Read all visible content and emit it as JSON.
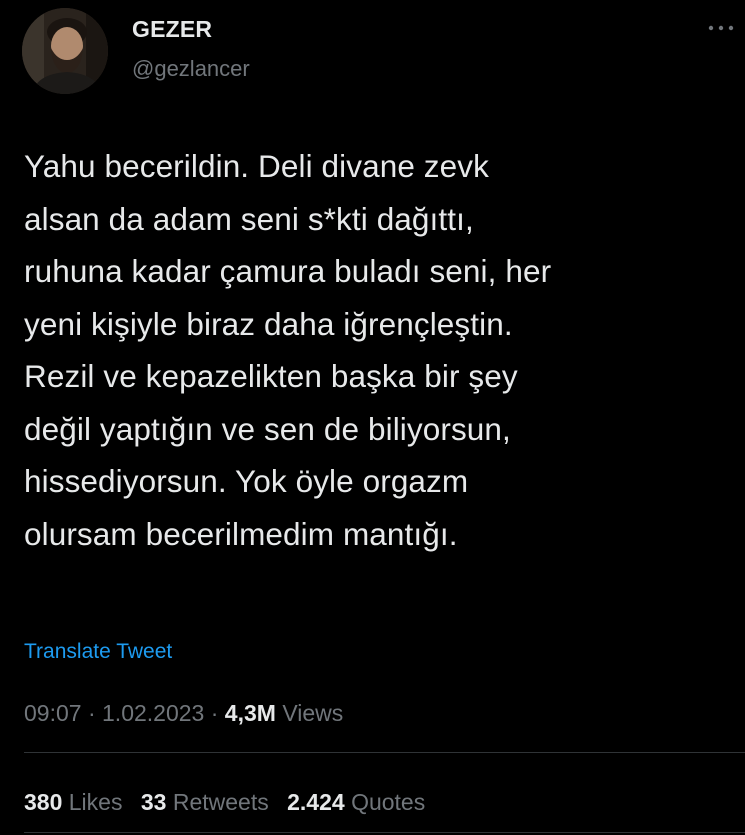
{
  "author": {
    "display_name": "GEZER",
    "handle": "@gezlancer",
    "avatar_icon": "user-avatar"
  },
  "more_icon": "more-dots-icon",
  "tweet": {
    "text": "Yahu becerildin. Deli divane zevk\nalsan da adam seni s*kti dağıttı,\nruhuna kadar çamura buladı seni, her\nyeni kişiyle biraz daha iğrençleştin.\nRezil ve kepazelikten başka bir şey\ndeğil yaptığın ve sen de biliyorsun,\nhissediyorsun. Yok öyle orgazm\nolursam becerilmedim mantığı.",
    "translate_label": "Translate Tweet"
  },
  "meta": {
    "time": "09:07",
    "separator": "·",
    "date": "1.02.2023",
    "views_count": "4,3M",
    "views_label": "Views"
  },
  "stats": {
    "likes_count": "380",
    "likes_label": "Likes",
    "retweets_count": "33",
    "retweets_label": "Retweets",
    "quotes_count": "2.424",
    "quotes_label": "Quotes"
  },
  "colors": {
    "background": "#000000",
    "primary_text": "#e7e9ea",
    "secondary_text": "#71767b",
    "link": "#1d9bf0",
    "divider": "#2f3336"
  }
}
